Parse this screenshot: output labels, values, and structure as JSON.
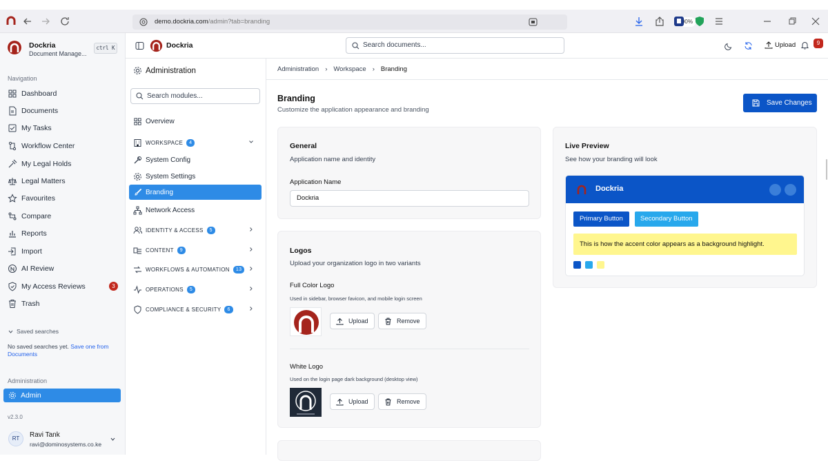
{
  "browser": {
    "url_domain": "demo.dockria.com",
    "url_path": "/admin?tab=branding",
    "zoom": "90%"
  },
  "sidebar": {
    "app_name": "Dockria",
    "app_subtitle": "Document Manage...",
    "shortcut": "ctrl K",
    "nav_label": "Navigation",
    "items": [
      {
        "label": "Dashboard"
      },
      {
        "label": "Documents"
      },
      {
        "label": "My Tasks"
      },
      {
        "label": "Workflow Center"
      },
      {
        "label": "My Legal Holds"
      },
      {
        "label": "Legal Matters"
      },
      {
        "label": "Favourites"
      },
      {
        "label": "Compare"
      },
      {
        "label": "Reports"
      },
      {
        "label": "Import"
      },
      {
        "label": "AI Review"
      },
      {
        "label": "My Access Reviews",
        "badge": "3"
      },
      {
        "label": "Trash"
      }
    ],
    "saved_searches_label": "Saved searches",
    "saved_empty_text": "No saved searches yet.",
    "saved_empty_link": "Save one from",
    "saved_empty_link2": "Documents",
    "admin_label": "Administration",
    "admin_item": "Admin",
    "version": "v2.3.0",
    "user_initials": "RT",
    "user_name": "Ravi Tank",
    "user_email": "ravi@dominosystems.co.ke"
  },
  "topbar": {
    "brand": "Dockria",
    "search_placeholder": "Search documents...",
    "upload_label": "Upload",
    "notif_count": "9"
  },
  "admin_panel": {
    "title": "Administration",
    "search_placeholder": "Search modules...",
    "overview": "Overview",
    "groups": [
      {
        "label": "WORKSPACE",
        "badge": "4"
      },
      {
        "label": "IDENTITY & ACCESS",
        "badge": "5"
      },
      {
        "label": "CONTENT",
        "badge": "9"
      },
      {
        "label": "WORKFLOWS & AUTOMATION",
        "badge": "13"
      },
      {
        "label": "OPERATIONS",
        "badge": "5"
      },
      {
        "label": "COMPLIANCE & SECURITY",
        "badge": "6"
      }
    ],
    "workspace_items": [
      "System Config",
      "System Settings",
      "Branding",
      "Network Access"
    ]
  },
  "breadcrumb": [
    "Administration",
    "Workspace",
    "Branding"
  ],
  "page": {
    "title": "Branding",
    "subtitle": "Customize the application appearance and branding",
    "save_label": "Save Changes"
  },
  "general": {
    "title": "General",
    "subtitle": "Application name and identity",
    "field_label": "Application Name",
    "field_value": "Dockria"
  },
  "logos": {
    "title": "Logos",
    "subtitle": "Upload your organization logo in two variants",
    "full_title": "Full Color Logo",
    "full_desc": "Used in sidebar, browser favicon, and mobile login screen",
    "white_title": "White Logo",
    "white_desc": "Used on the login page dark background (desktop view)",
    "upload": "Upload",
    "remove": "Remove"
  },
  "preview": {
    "title": "Live Preview",
    "subtitle": "See how your branding will look",
    "brand": "Dockria",
    "primary_btn": "Primary Button",
    "secondary_btn": "Secondary Button",
    "highlight_text": "This is how the accent color appears as a background highlight.",
    "colors": {
      "primary": "#0b55c7",
      "secondary": "#28a8ec",
      "accent": "#fff68e"
    }
  }
}
